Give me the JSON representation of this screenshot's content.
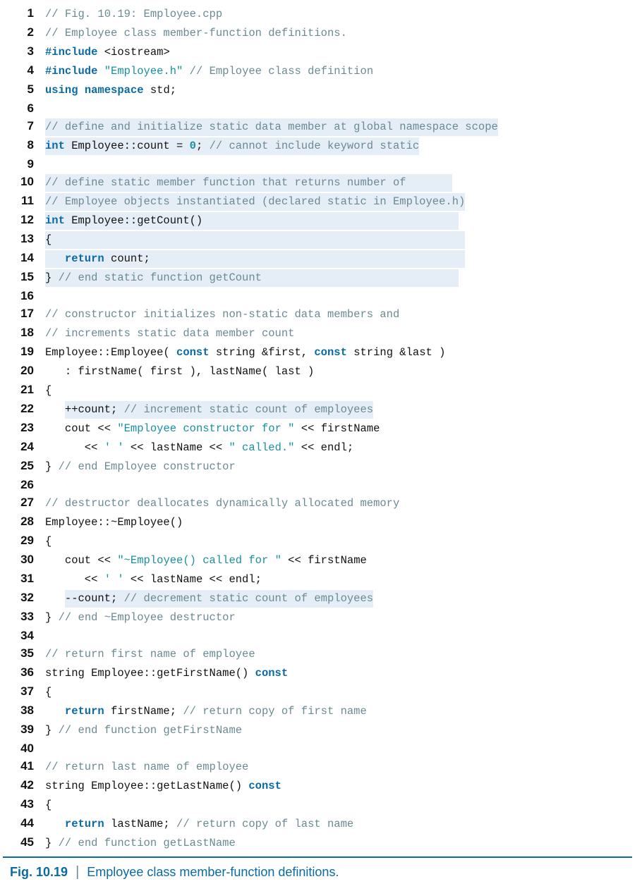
{
  "caption": {
    "label": "Fig. 10.19",
    "separator": "|",
    "text": "Employee class member-function definitions."
  },
  "lines": [
    {
      "n": "1",
      "hl": [
        false
      ],
      "seg": [
        [
          [
            "cm",
            "// Fig. 10.19: Employee.cpp"
          ]
        ]
      ]
    },
    {
      "n": "2",
      "hl": [
        false
      ],
      "seg": [
        [
          [
            "cm",
            "// Employee class member-function definitions."
          ]
        ]
      ]
    },
    {
      "n": "3",
      "hl": [
        false
      ],
      "seg": [
        [
          [
            "kw",
            "#include"
          ],
          [
            "id",
            " "
          ],
          [
            "id",
            "<iostream>"
          ]
        ]
      ]
    },
    {
      "n": "4",
      "hl": [
        false
      ],
      "seg": [
        [
          [
            "kw",
            "#include"
          ],
          [
            "id",
            " "
          ],
          [
            "str",
            "\"Employee.h\""
          ],
          [
            "id",
            " "
          ],
          [
            "cm",
            "// Employee class definition"
          ]
        ]
      ]
    },
    {
      "n": "5",
      "hl": [
        false
      ],
      "seg": [
        [
          [
            "kw",
            "using"
          ],
          [
            "id",
            " "
          ],
          [
            "kw",
            "namespace"
          ],
          [
            "id",
            " std;"
          ]
        ]
      ]
    },
    {
      "n": "6",
      "hl": [
        false
      ],
      "seg": [
        [
          [
            "id",
            ""
          ]
        ]
      ]
    },
    {
      "n": "7",
      "hl": [
        true
      ],
      "seg": [
        [
          [
            "cm",
            "// define and initialize static data member at global namespace scope"
          ]
        ]
      ]
    },
    {
      "n": "8",
      "hl": [
        true
      ],
      "seg": [
        [
          [
            "kw",
            "int"
          ],
          [
            "id",
            " Employee::count = "
          ],
          [
            "num",
            "0"
          ],
          [
            "id",
            "; "
          ],
          [
            "cm",
            "// cannot include keyword static"
          ]
        ]
      ]
    },
    {
      "n": "9",
      "hl": [
        false
      ],
      "seg": [
        [
          [
            "id",
            ""
          ]
        ]
      ]
    },
    {
      "n": "10",
      "hl": [
        true
      ],
      "seg": [
        [
          [
            "cm",
            "// define static member function that returns number of       "
          ]
        ]
      ]
    },
    {
      "n": "11",
      "hl": [
        true
      ],
      "seg": [
        [
          [
            "cm",
            "// Employee objects instantiated (declared static in Employee.h)"
          ]
        ]
      ]
    },
    {
      "n": "12",
      "hl": [
        true
      ],
      "seg": [
        [
          [
            "kw",
            "int"
          ],
          [
            "id",
            " Employee::getCount()                                       "
          ]
        ]
      ]
    },
    {
      "n": "13",
      "hl": [
        true
      ],
      "seg": [
        [
          [
            "id",
            "{                                                               "
          ]
        ]
      ]
    },
    {
      "n": "14",
      "hl": [
        true
      ],
      "seg": [
        [
          [
            "id",
            "   "
          ],
          [
            "kw",
            "return"
          ],
          [
            "id",
            " count;                                                "
          ]
        ]
      ]
    },
    {
      "n": "15",
      "hl": [
        true
      ],
      "seg": [
        [
          [
            "id",
            "} "
          ],
          [
            "cm",
            "// end static function getCount                              "
          ]
        ]
      ]
    },
    {
      "n": "16",
      "hl": [
        false
      ],
      "seg": [
        [
          [
            "id",
            ""
          ]
        ]
      ]
    },
    {
      "n": "17",
      "hl": [
        false
      ],
      "seg": [
        [
          [
            "cm",
            "// constructor initializes non-static data members and"
          ]
        ]
      ]
    },
    {
      "n": "18",
      "hl": [
        false
      ],
      "seg": [
        [
          [
            "cm",
            "// increments static data member count"
          ]
        ]
      ]
    },
    {
      "n": "19",
      "hl": [
        false
      ],
      "seg": [
        [
          [
            "id",
            "Employee::Employee( "
          ],
          [
            "kw",
            "const"
          ],
          [
            "id",
            " string &first, "
          ],
          [
            "kw",
            "const"
          ],
          [
            "id",
            " string &last )"
          ]
        ]
      ]
    },
    {
      "n": "20",
      "hl": [
        false
      ],
      "seg": [
        [
          [
            "id",
            "   : firstName( first ), lastName( last )"
          ]
        ]
      ]
    },
    {
      "n": "21",
      "hl": [
        false
      ],
      "seg": [
        [
          [
            "id",
            "{"
          ]
        ]
      ]
    },
    {
      "n": "22",
      "hl": [
        false,
        true
      ],
      "seg": [
        [
          [
            "id",
            "   "
          ]
        ],
        [
          [
            "id",
            "++count; "
          ],
          [
            "cm",
            "// increment static count of employees"
          ]
        ]
      ]
    },
    {
      "n": "23",
      "hl": [
        false
      ],
      "seg": [
        [
          [
            "id",
            "   cout << "
          ],
          [
            "str",
            "\"Employee constructor for \""
          ],
          [
            "id",
            " << firstName"
          ]
        ]
      ]
    },
    {
      "n": "24",
      "hl": [
        false
      ],
      "seg": [
        [
          [
            "id",
            "      << "
          ],
          [
            "str",
            "' '"
          ],
          [
            "id",
            " << lastName << "
          ],
          [
            "str",
            "\" called.\""
          ],
          [
            "id",
            " << endl;"
          ]
        ]
      ]
    },
    {
      "n": "25",
      "hl": [
        false
      ],
      "seg": [
        [
          [
            "id",
            "} "
          ],
          [
            "cm",
            "// end Employee constructor"
          ]
        ]
      ]
    },
    {
      "n": "26",
      "hl": [
        false
      ],
      "seg": [
        [
          [
            "id",
            ""
          ]
        ]
      ]
    },
    {
      "n": "27",
      "hl": [
        false
      ],
      "seg": [
        [
          [
            "cm",
            "// destructor deallocates dynamically allocated memory"
          ]
        ]
      ]
    },
    {
      "n": "28",
      "hl": [
        false
      ],
      "seg": [
        [
          [
            "id",
            "Employee::~Employee()"
          ]
        ]
      ]
    },
    {
      "n": "29",
      "hl": [
        false
      ],
      "seg": [
        [
          [
            "id",
            "{"
          ]
        ]
      ]
    },
    {
      "n": "30",
      "hl": [
        false
      ],
      "seg": [
        [
          [
            "id",
            "   cout << "
          ],
          [
            "str",
            "\"~Employee() called for \""
          ],
          [
            "id",
            " << firstName"
          ]
        ]
      ]
    },
    {
      "n": "31",
      "hl": [
        false
      ],
      "seg": [
        [
          [
            "id",
            "      << "
          ],
          [
            "str",
            "' '"
          ],
          [
            "id",
            " << lastName << endl;"
          ]
        ]
      ]
    },
    {
      "n": "32",
      "hl": [
        false,
        true
      ],
      "seg": [
        [
          [
            "id",
            "   "
          ]
        ],
        [
          [
            "id",
            "--count; "
          ],
          [
            "cm",
            "// decrement static count of employees"
          ]
        ]
      ]
    },
    {
      "n": "33",
      "hl": [
        false
      ],
      "seg": [
        [
          [
            "id",
            "} "
          ],
          [
            "cm",
            "// end ~Employee destructor"
          ]
        ]
      ]
    },
    {
      "n": "34",
      "hl": [
        false
      ],
      "seg": [
        [
          [
            "id",
            ""
          ]
        ]
      ]
    },
    {
      "n": "35",
      "hl": [
        false
      ],
      "seg": [
        [
          [
            "cm",
            "// return first name of employee"
          ]
        ]
      ]
    },
    {
      "n": "36",
      "hl": [
        false
      ],
      "seg": [
        [
          [
            "id",
            "string Employee::getFirstName() "
          ],
          [
            "kw",
            "const"
          ]
        ]
      ]
    },
    {
      "n": "37",
      "hl": [
        false
      ],
      "seg": [
        [
          [
            "id",
            "{"
          ]
        ]
      ]
    },
    {
      "n": "38",
      "hl": [
        false
      ],
      "seg": [
        [
          [
            "id",
            "   "
          ],
          [
            "kw",
            "return"
          ],
          [
            "id",
            " firstName; "
          ],
          [
            "cm",
            "// return copy of first name"
          ]
        ]
      ]
    },
    {
      "n": "39",
      "hl": [
        false
      ],
      "seg": [
        [
          [
            "id",
            "} "
          ],
          [
            "cm",
            "// end function getFirstName"
          ]
        ]
      ]
    },
    {
      "n": "40",
      "hl": [
        false
      ],
      "seg": [
        [
          [
            "id",
            ""
          ]
        ]
      ]
    },
    {
      "n": "41",
      "hl": [
        false
      ],
      "seg": [
        [
          [
            "cm",
            "// return last name of employee"
          ]
        ]
      ]
    },
    {
      "n": "42",
      "hl": [
        false
      ],
      "seg": [
        [
          [
            "id",
            "string Employee::getLastName() "
          ],
          [
            "kw",
            "const"
          ]
        ]
      ]
    },
    {
      "n": "43",
      "hl": [
        false
      ],
      "seg": [
        [
          [
            "id",
            "{"
          ]
        ]
      ]
    },
    {
      "n": "44",
      "hl": [
        false
      ],
      "seg": [
        [
          [
            "id",
            "   "
          ],
          [
            "kw",
            "return"
          ],
          [
            "id",
            " lastName; "
          ],
          [
            "cm",
            "// return copy of last name"
          ]
        ]
      ]
    },
    {
      "n": "45",
      "hl": [
        false
      ],
      "seg": [
        [
          [
            "id",
            "} "
          ],
          [
            "cm",
            "// end function getLastName"
          ]
        ]
      ]
    }
  ]
}
